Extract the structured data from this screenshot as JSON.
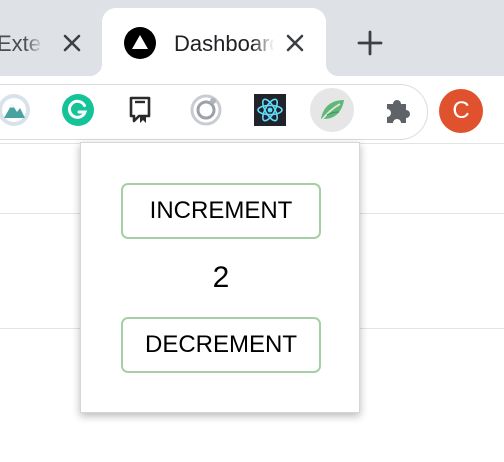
{
  "tabs": [
    {
      "label": "Extension",
      "active": false,
      "close_icon": "close-icon"
    },
    {
      "label": "Dashboard",
      "active": true,
      "favicon": "triangle-logo-icon",
      "close_icon": "close-icon"
    }
  ],
  "new_tab_icon": "plus-icon",
  "extensions": [
    {
      "name": "mountain-extension-icon"
    },
    {
      "name": "grammarly-icon",
      "color": "#15c39a"
    },
    {
      "name": "reader-bookmark-icon"
    },
    {
      "name": "ring-extension-icon"
    },
    {
      "name": "react-devtools-icon",
      "color": "#61dafb"
    },
    {
      "name": "leaf-extension-icon",
      "active": true,
      "color": "#5fb878"
    },
    {
      "name": "puzzle-extensions-icon"
    }
  ],
  "profile": {
    "initial": "C",
    "color": "#e0522d"
  },
  "popup": {
    "increment_label": "INCREMENT",
    "count": "2",
    "decrement_label": "DECREMENT",
    "button_border_color": "#a7cfa4"
  }
}
